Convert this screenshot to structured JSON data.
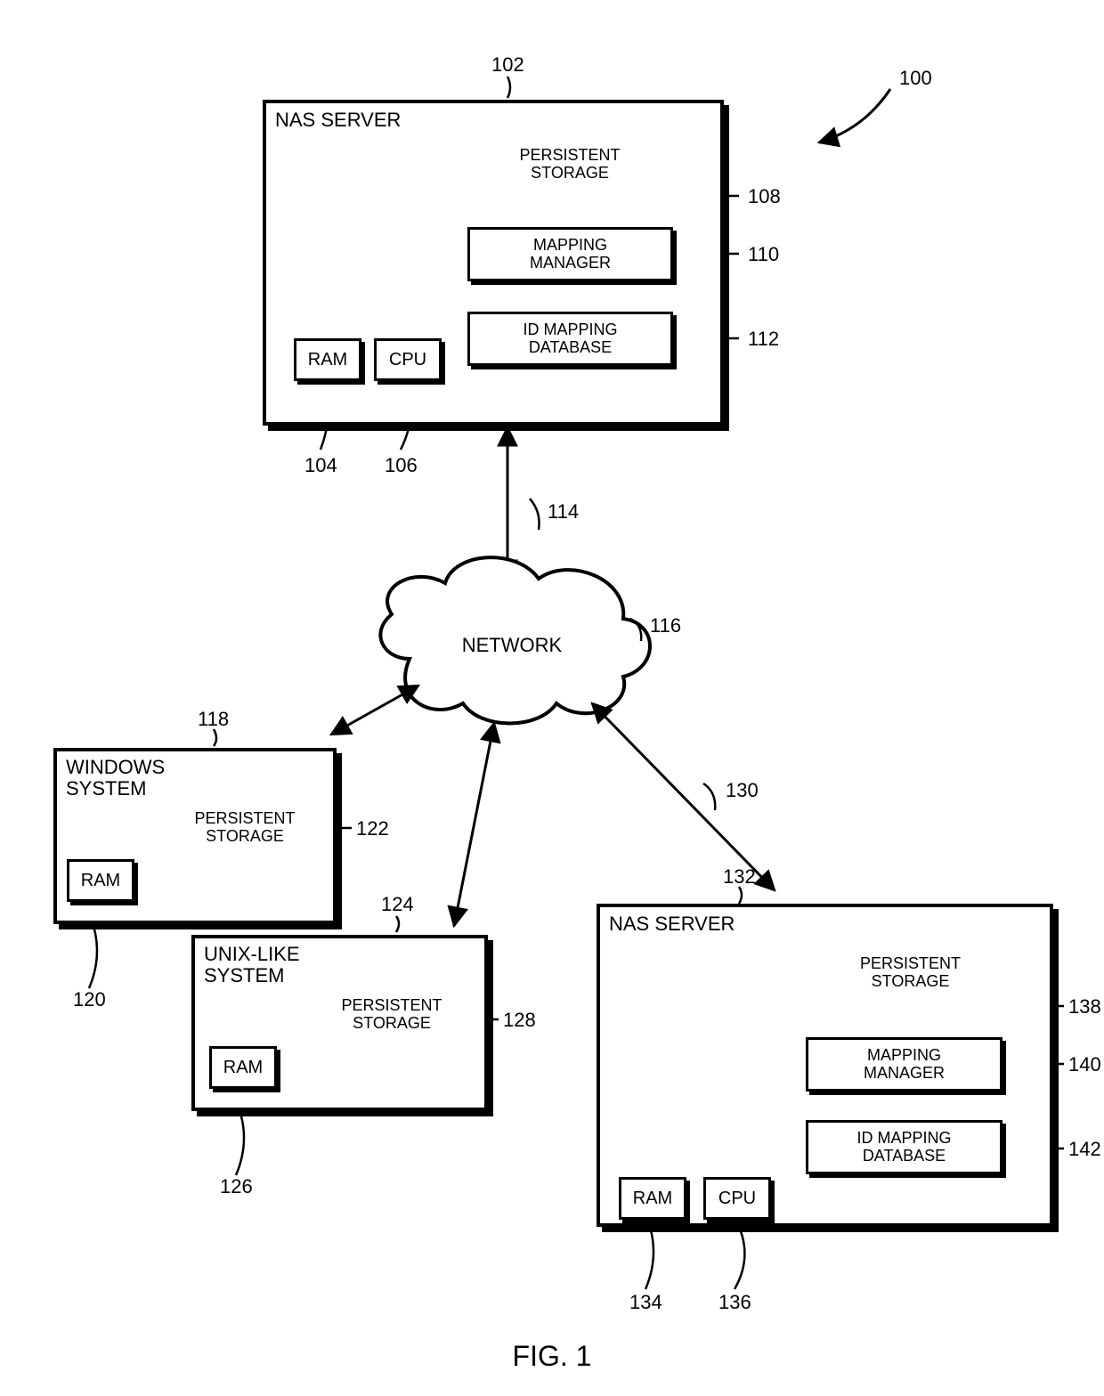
{
  "figure_label": "FIG. 1",
  "ref": {
    "r100": "100",
    "r102": "102",
    "r104": "104",
    "r106": "106",
    "r108": "108",
    "r110": "110",
    "r112": "112",
    "r114": "114",
    "r116": "116",
    "r118": "118",
    "r120": "120",
    "r122": "122",
    "r124": "124",
    "r126": "126",
    "r128": "128",
    "r130": "130",
    "r132": "132",
    "r134": "134",
    "r136": "136",
    "r138": "138",
    "r140": "140",
    "r142": "142"
  },
  "text": {
    "nas_server": "NAS SERVER",
    "persistent_storage": "PERSISTENT\nSTORAGE",
    "mapping_manager": "MAPPING\nMANAGER",
    "id_mapping_db": "ID MAPPING\nDATABASE",
    "ram": "RAM",
    "cpu": "CPU",
    "network": "NETWORK",
    "windows_system": "WINDOWS\nSYSTEM",
    "unix_system": "UNIX-LIKE\nSYSTEM"
  }
}
